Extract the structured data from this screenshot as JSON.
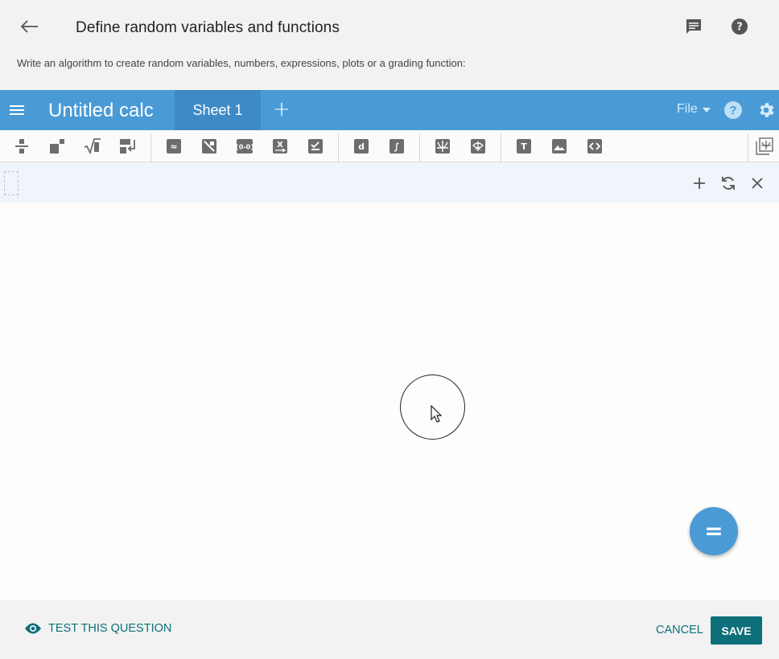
{
  "header": {
    "title": "Define random variables and functions",
    "instructions": "Write an algorithm to create random variables, numbers, expressions, plots or a grading function:",
    "back_icon": "arrow-left-icon",
    "chat_icon": "chat-icon",
    "help_icon": "help-circle-icon"
  },
  "calc": {
    "title": "Untitled calc",
    "sheet_tab": "Sheet 1",
    "add_sheet": "+",
    "file_menu": "File",
    "accent": "#4a9ad6",
    "toolbar_box_labels": {
      "approx": "≈",
      "text": "T",
      "derivative": "d",
      "integral": "∫"
    }
  },
  "canvas": {
    "fab_label": "="
  },
  "footer": {
    "test_label": "TEST THIS QUESTION",
    "cancel_label": "CANCEL",
    "save_label": "SAVE",
    "accent": "#0d6f7a"
  }
}
